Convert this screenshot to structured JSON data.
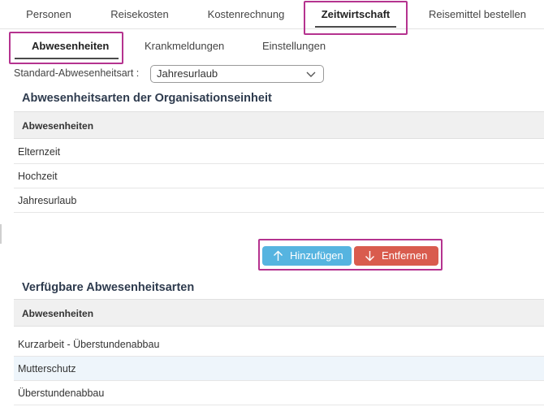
{
  "top_tabs": [
    {
      "label": "Personen"
    },
    {
      "label": "Reisekosten"
    },
    {
      "label": "Kostenrechnung"
    },
    {
      "label": "Zeitwirtschaft"
    },
    {
      "label": "Reisemittel bestellen"
    }
  ],
  "active_top_tab": "Zeitwirtschaft",
  "sub_tabs": [
    {
      "label": "Abwesenheiten"
    },
    {
      "label": "Krankmeldungen"
    },
    {
      "label": "Einstellungen"
    }
  ],
  "active_sub_tab": "Abwesenheiten",
  "default_type": {
    "label": "Standard-Abwesenheitsart :",
    "value": "Jahresurlaub",
    "icon": "chevron-down-icon"
  },
  "org_section": {
    "title": "Abwesenheitsarten der Organisationseinheit",
    "column_header": "Abwesenheiten",
    "rows": [
      "Elternzeit",
      "Hochzeit",
      "Jahresurlaub"
    ]
  },
  "actions": {
    "add_label": "Hinzufügen",
    "add_icon": "arrow-up-icon",
    "remove_label": "Entfernen",
    "remove_icon": "arrow-down-icon"
  },
  "available_section": {
    "title": "Verfügbare Abwesenheitsarten",
    "column_header": "Abwesenheiten",
    "rows": [
      "Kurzarbeit - Überstundenabbau",
      "Mutterschutz",
      "Überstundenabbau"
    ],
    "selected_row": "Mutterschutz"
  },
  "colors": {
    "highlight_frame": "#b5338f",
    "add_button": "#56b4e0",
    "remove_button": "#d95c4e",
    "section_title": "#2e3b4e",
    "selected_row": "#eef5fb"
  }
}
